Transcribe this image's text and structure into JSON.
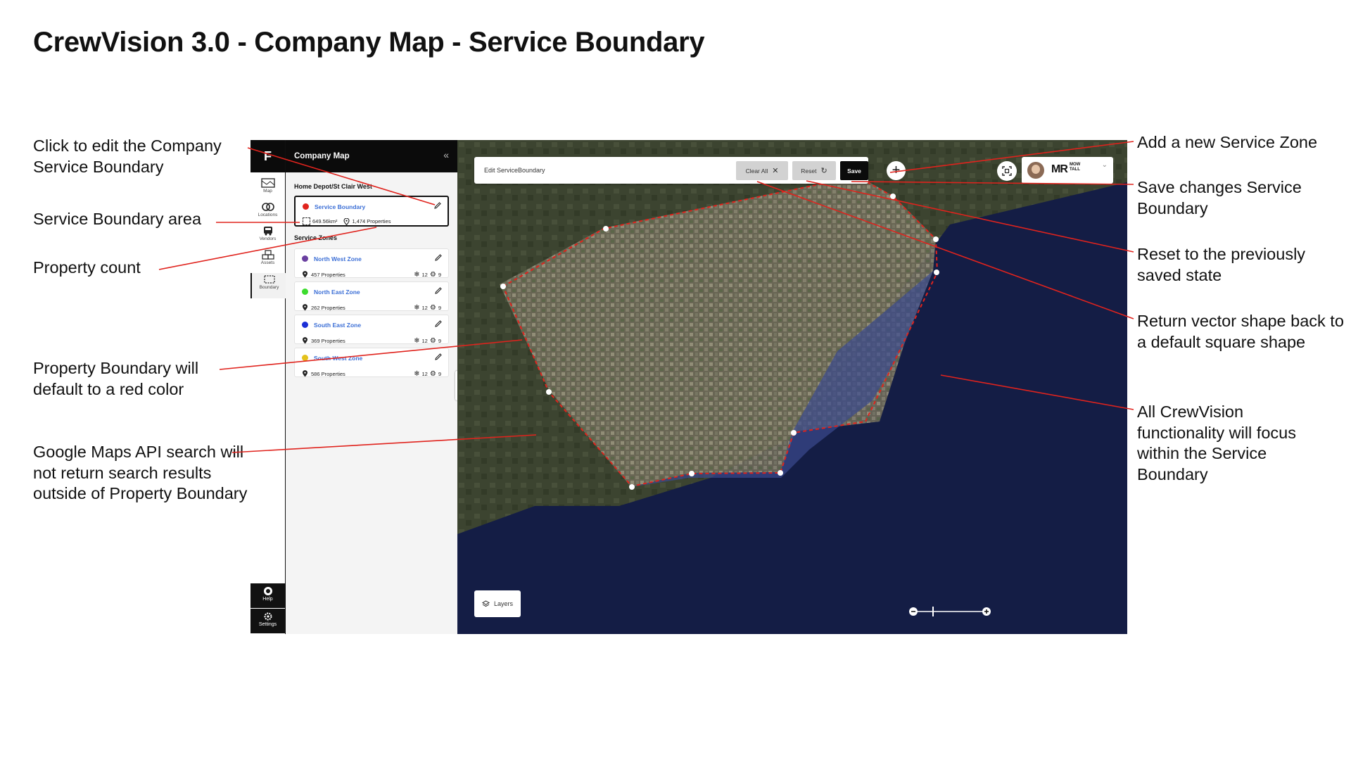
{
  "page_title": "CrewVision 3.0 - Company Map - Service Boundary",
  "annotations_left": {
    "edit_boundary": "Click to edit the Company Service Boundary",
    "boundary_area": "Service Boundary area",
    "property_count": "Property count",
    "red_color": "Property Boundary will default to a red color",
    "search_limit": "Google Maps API search will not return search results outside of Property Boundary"
  },
  "annotations_right": {
    "add_zone": "Add a new Service Zone",
    "save": "Save changes Service Boundary",
    "reset": "Reset to the previously saved state",
    "clear": "Return vector shape back to a default square shape",
    "focus": "All CrewVision functionality will focus within the Service Boundary"
  },
  "rail": {
    "logo": "F",
    "items": [
      {
        "label": "Map",
        "icon": "map-icon"
      },
      {
        "label": "Locations",
        "icon": "locations-icon"
      },
      {
        "label": "Vendors",
        "icon": "vendors-icon"
      },
      {
        "label": "Assets",
        "icon": "assets-icon"
      },
      {
        "label": "Boundary",
        "icon": "boundary-icon"
      }
    ],
    "help": "Help",
    "settings": "Settings"
  },
  "panel": {
    "title": "Company Map",
    "collapse": "«",
    "location": "Home Depot/St Clair West",
    "service_boundary": {
      "name": "Service Boundary",
      "color": "#e0231d",
      "area": "649.56km²",
      "properties": "1,474 Properties"
    },
    "zones_label": "Service Zones",
    "zones": [
      {
        "name": "North West Zone",
        "color": "#6a3fa0",
        "properties": "457 Properties",
        "snow": "12",
        "gear": "9"
      },
      {
        "name": "North East Zone",
        "color": "#3ddc2e",
        "properties": "262 Properties",
        "snow": "12",
        "gear": "9"
      },
      {
        "name": "South East Zone",
        "color": "#1b2fd6",
        "properties": "369 Properties",
        "snow": "12",
        "gear": "9"
      },
      {
        "name": "South West Zone",
        "color": "#e4c21c",
        "properties": "586 Properties",
        "snow": "12",
        "gear": "9"
      }
    ]
  },
  "toolbar": {
    "label": "Edit ServiceBoundary",
    "clear_all": "Clear All",
    "reset": "Reset",
    "save": "Save"
  },
  "account": {
    "brand": "MR",
    "brand_small_1": "MOW",
    "brand_small_2": "TALL"
  },
  "map": {
    "layers": "Layers",
    "boundary_color": "#e0231d",
    "water_color": "#14204a"
  }
}
